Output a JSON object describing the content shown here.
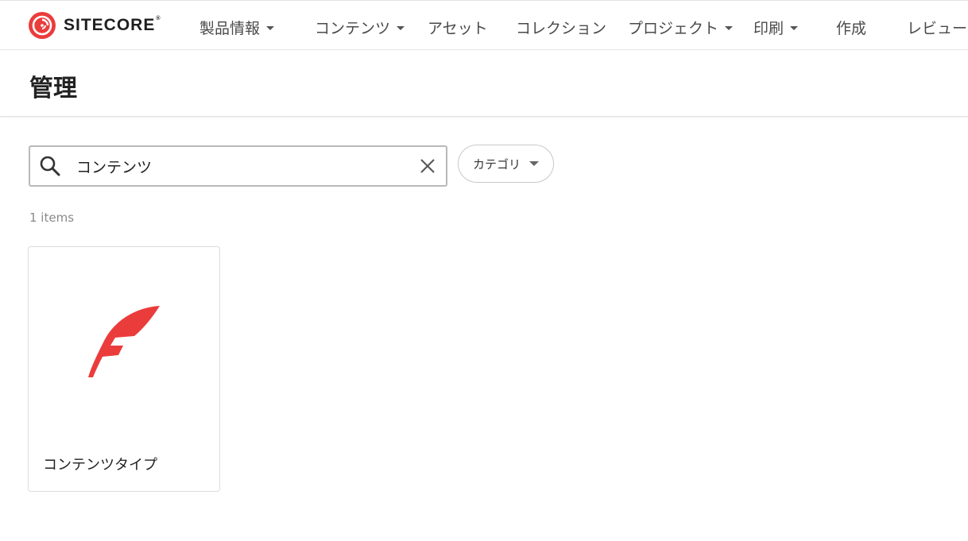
{
  "header": {
    "brand_name": "SITECORE",
    "brand_reg": "®",
    "nav": [
      {
        "label": "製品情報",
        "dropdown": true
      },
      {
        "label": "コンテンツ",
        "dropdown": true
      },
      {
        "label": "アセット",
        "dropdown": false
      },
      {
        "label": "コレクション",
        "dropdown": false
      },
      {
        "label": "プロジェクト",
        "dropdown": true
      },
      {
        "label": "印刷",
        "dropdown": true
      },
      {
        "label": "作成",
        "dropdown": false
      },
      {
        "label": "レビュー",
        "dropdown": false
      }
    ]
  },
  "page": {
    "title": "管理"
  },
  "search": {
    "value": "コンテンツ",
    "placeholder": ""
  },
  "filter": {
    "category_label": "カテゴリ"
  },
  "results": {
    "count_text": "1 items",
    "items": [
      {
        "label": "コンテンツタイプ",
        "icon": "feather-icon"
      }
    ]
  },
  "colors": {
    "brand_red": "#eb3c3c",
    "nav_text": "#4a4a4a"
  }
}
